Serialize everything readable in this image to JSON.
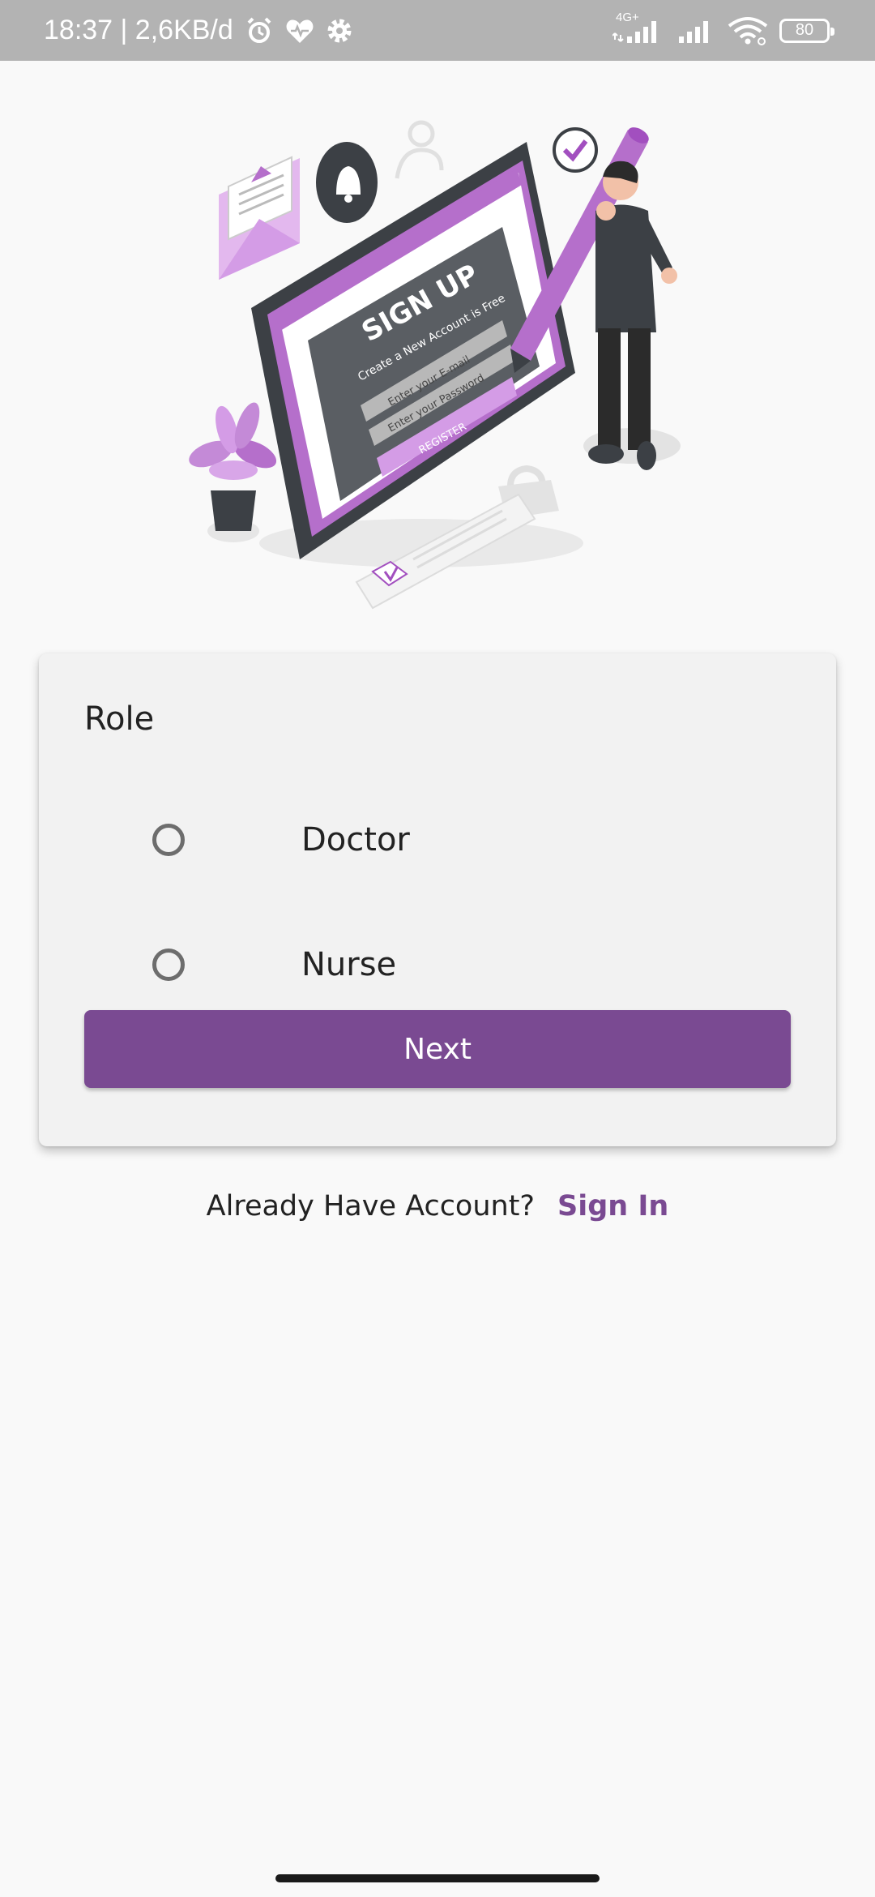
{
  "status": {
    "time_net": "18:37 | 2,6KB/d",
    "network_type": "4G+",
    "battery": "80"
  },
  "illustration": {
    "sign_up": "SIGN UP",
    "subtitle": "Create a New Account is Free",
    "email_placeholder": "Enter your E-mail",
    "password_placeholder": "Enter your Password",
    "register": "REGISTER"
  },
  "form": {
    "role_label": "Role",
    "options": [
      {
        "label": "Doctor",
        "selected": false
      },
      {
        "label": "Nurse",
        "selected": false
      }
    ],
    "next_label": "Next"
  },
  "footer": {
    "prompt": "Already Have Account?",
    "sign_in": "Sign In"
  },
  "colors": {
    "accent": "#7a4a92",
    "status_bar": "#b3b3b3",
    "background": "#f9f9f9"
  }
}
